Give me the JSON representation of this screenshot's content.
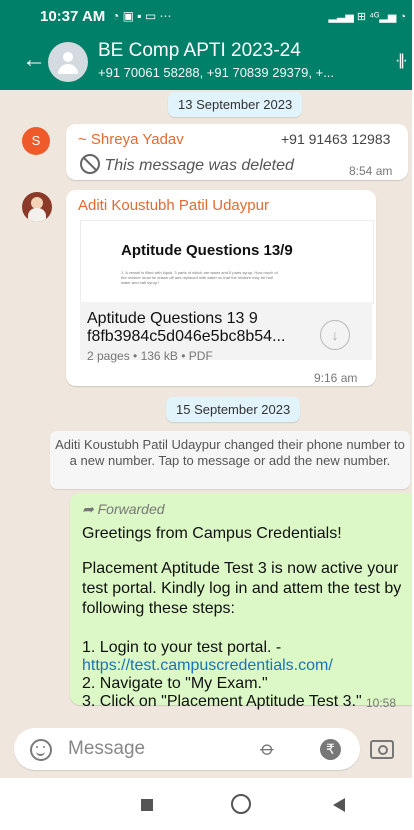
{
  "status_bar": {
    "time": "10:37 AM",
    "left_icons": "◔ ▣ ▪ ▭ ⋯",
    "right_icons": "▂▃▅ ⊞ ⁴ᴳ▂▅ ◔"
  },
  "chat": {
    "title": "BE Comp APTI 2023-24",
    "subtitle": "+91 70061 58288, +91 70839 29379, +..."
  },
  "dates": {
    "first": "13 September 2023",
    "second": "15 September 2023"
  },
  "messages": {
    "shreya": {
      "avatar_letter": "S",
      "sender": "~ Shreya Yadav",
      "phone": "+91 91463 12983",
      "text": "This message was deleted",
      "time": "8:54 am"
    },
    "aditi": {
      "sender": "Aditi Koustubh Patil Udaypur",
      "preview_title": "Aptitude Questions 13/9",
      "preview_line1": "1. A vessel is filled with liquid, 3 parts of which are water and 5 parts syrup. How much of",
      "preview_line2": "the mixture must be drawn off and replaced with water so that the mixture may be half",
      "preview_line3": "water and half syrup?",
      "file_title": "Aptitude Questions 13 9 f8fb3984c5d046e5bc8b54...",
      "file_meta": "2 pages • 136 kB • PDF",
      "time": "9:16 am"
    },
    "system": "Aditi Koustubh Patil Udaypur changed their phone number to a new number. Tap to message or add the new number.",
    "forwarded": {
      "label": "Forwarded",
      "line1": "Greetings from Campus Credentials!",
      "line2": "Placement Aptitude Test 3 is now active your test portal. Kindly log in and attem the test by following these steps:",
      "step1": "1. Login to your test portal. -",
      "link": "https://test.campuscredentials.com/",
      "step2": "2. Navigate to \"My Exam.\"",
      "step3": "3. Click on \"Placement Aptitude Test 3.\"",
      "time": "10:58"
    }
  },
  "composer": {
    "placeholder": "Message"
  }
}
